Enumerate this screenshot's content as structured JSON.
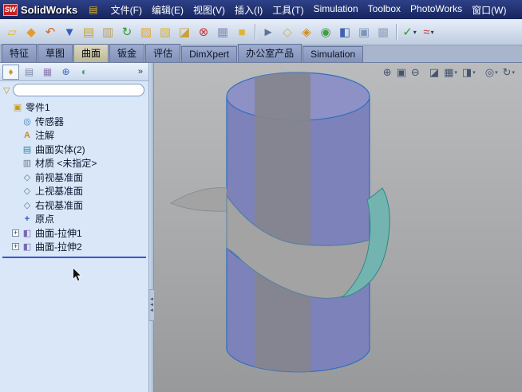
{
  "app": {
    "logo_badge": "SW",
    "logo_text": "SolidWorks"
  },
  "glyphs": {
    "doc_icon": "▤",
    "caret": "▾",
    "plus": "+",
    "overflow": "»",
    "funnel": "▽",
    "splitter_arrow": "◄"
  },
  "colors": {
    "brand_red": "#c42222",
    "edge_blue": "#2e6fc0",
    "cylinder_fill": "#7e82ba",
    "cylinder_top_fill": "#8d91c6",
    "stripe_fill": "#85858d",
    "surface_fill": "#a3a3a3",
    "surface_back_fill": "#74b4b0",
    "surface_edge": "#2e8a86",
    "rollback_blue": "#3a56d4"
  },
  "menu": {
    "items": [
      {
        "name": "menu-file",
        "label": "文件(F)"
      },
      {
        "name": "menu-edit",
        "label": "编辑(E)"
      },
      {
        "name": "menu-view",
        "label": "视图(V)"
      },
      {
        "name": "menu-insert",
        "label": "插入(I)"
      },
      {
        "name": "menu-tools",
        "label": "工具(T)"
      },
      {
        "name": "menu-simulation",
        "label": "Simulation"
      },
      {
        "name": "menu-toolbox",
        "label": "Toolbox"
      },
      {
        "name": "menu-photoworks",
        "label": "PhotoWorks"
      },
      {
        "name": "menu-window",
        "label": "窗口(W)"
      }
    ]
  },
  "toolbar": {
    "buttons": [
      {
        "name": "new-document-button",
        "glyph": "▱",
        "color": "#e7b52f"
      },
      {
        "name": "open-document-button",
        "glyph": "◆",
        "color": "#e59b28"
      },
      {
        "name": "undo-button",
        "glyph": "↶",
        "color": "#d2691e"
      },
      {
        "name": "save-button",
        "glyph": "▼",
        "color": "#2f5fc0"
      },
      {
        "name": "print-button",
        "glyph": "▤",
        "color": "#caa22e"
      },
      {
        "name": "print-preview-button",
        "glyph": "▥",
        "color": "#b8a060"
      },
      {
        "name": "rebuild-button",
        "glyph": "↻",
        "color": "#2f9e2f"
      },
      {
        "name": "open-folder-button",
        "glyph": "▨",
        "color": "#e5a428"
      },
      {
        "name": "make-drawing-button",
        "glyph": "▧",
        "color": "#d9b232"
      },
      {
        "name": "make-assembly-button",
        "glyph": "◪",
        "color": "#c9a232"
      },
      {
        "name": "delete-button",
        "glyph": "⊗",
        "color": "#cc3333"
      },
      {
        "name": "sheet-button",
        "glyph": "▦",
        "color": "#7f93b5"
      },
      {
        "name": "box-button",
        "glyph": "■",
        "color": "#ddb53a"
      },
      {
        "type": "sep"
      },
      {
        "name": "select-button",
        "glyph": "►",
        "color": "#5d7294"
      },
      {
        "name": "sketch-button",
        "glyph": "◇",
        "color": "#d9b232"
      },
      {
        "name": "dimension-button",
        "glyph": "◈",
        "color": "#c98f2a"
      },
      {
        "name": "measure-button",
        "glyph": "◉",
        "color": "#3f9e3f"
      },
      {
        "name": "section-button",
        "glyph": "◧",
        "color": "#3f63ae"
      },
      {
        "name": "view-settings-button",
        "glyph": "▣",
        "color": "#8195b7"
      },
      {
        "name": "tools-button",
        "glyph": "▩",
        "color": "#93a3bd"
      },
      {
        "type": "sep"
      },
      {
        "name": "select-filter-button",
        "glyph": "✓",
        "color": "#2f9e2f",
        "caret": true
      },
      {
        "name": "spline-button",
        "glyph": "≈",
        "color": "#c03a3a",
        "caret": true
      }
    ]
  },
  "command_tabs": {
    "tabs": [
      {
        "name": "tab-features",
        "label": "特征",
        "active": false
      },
      {
        "name": "tab-sketch",
        "label": "草图",
        "active": false
      },
      {
        "name": "tab-surfaces",
        "label": "曲面",
        "active": true
      },
      {
        "name": "tab-sheet-metal",
        "label": "钣金",
        "active": false
      },
      {
        "name": "tab-evaluate",
        "label": "评估",
        "active": false
      },
      {
        "name": "tab-dimxpert",
        "label": "DimXpert",
        "active": false
      },
      {
        "name": "tab-office-products",
        "label": "办公室产品",
        "active": false
      },
      {
        "name": "tab-simulation",
        "label": "Simulation",
        "active": false
      }
    ]
  },
  "feature_panel": {
    "overflow_label": "»",
    "tabs": [
      {
        "name": "featuremanager-tab",
        "glyph": "♦",
        "color": "#c79a28",
        "active": true
      },
      {
        "name": "propertymanager-tab",
        "glyph": "▤",
        "color": "#7a8aa8",
        "active": false
      },
      {
        "name": "configurationmanager-tab",
        "glyph": "▦",
        "color": "#8a7ab0",
        "active": false
      },
      {
        "name": "dimxpertmanager-tab",
        "glyph": "⊕",
        "color": "#3a6ac0",
        "active": false
      },
      {
        "name": "displaymanager-tab",
        "glyph": "◐",
        "color": "#3a9a6a",
        "active": false
      }
    ],
    "filter": {
      "value": ""
    },
    "tree": {
      "items": [
        {
          "name": "tree-item-part",
          "label": "零件1",
          "icon": "part-icon",
          "glyph": "▣",
          "color": "#c79a28",
          "indent": 0,
          "expander": "none"
        },
        {
          "name": "tree-item-sensors",
          "label": "传感器",
          "icon": "sensors-icon",
          "glyph": "◎",
          "color": "#3a7ac0",
          "indent": 1,
          "expander": "none"
        },
        {
          "name": "tree-item-annotations",
          "label": "注解",
          "icon": "annotations-icon",
          "glyph": "A",
          "color": "#d08a20",
          "indent": 1,
          "expander": "none"
        },
        {
          "name": "tree-item-surface-bodies",
          "label": "曲面实体(2)",
          "icon": "surface-bodies-icon",
          "glyph": "▤",
          "color": "#2a8aa0",
          "indent": 1,
          "expander": "none"
        },
        {
          "name": "tree-item-material",
          "label": "材质 <未指定>",
          "icon": "material-icon",
          "glyph": "▥",
          "color": "#6a7a90",
          "indent": 1,
          "expander": "none"
        },
        {
          "name": "tree-item-front-plane",
          "label": "前视基准面",
          "icon": "plane-icon",
          "glyph": "◇",
          "color": "#5a7aa0",
          "indent": 1,
          "expander": "none"
        },
        {
          "name": "tree-item-top-plane",
          "label": "上视基准面",
          "icon": "plane-icon",
          "glyph": "◇",
          "color": "#5a7aa0",
          "indent": 1,
          "expander": "none"
        },
        {
          "name": "tree-item-right-plane",
          "label": "右视基准面",
          "icon": "plane-icon",
          "glyph": "◇",
          "color": "#5a7aa0",
          "indent": 1,
          "expander": "none"
        },
        {
          "name": "tree-item-origin",
          "label": "原点",
          "icon": "origin-icon",
          "glyph": "+",
          "color": "#2a5ac0",
          "indent": 1,
          "expander": "none"
        },
        {
          "name": "tree-item-surface-extrude1",
          "label": "曲面-拉伸1",
          "icon": "surface-extrude-icon",
          "glyph": "◧",
          "color": "#7a6ab0",
          "indent": 1,
          "expander": "plus"
        },
        {
          "name": "tree-item-surface-extrude2",
          "label": "曲面-拉伸2",
          "icon": "surface-extrude-icon",
          "glyph": "◧",
          "color": "#7a6ab0",
          "indent": 1,
          "expander": "plus"
        }
      ]
    }
  },
  "viewport": {
    "hud_icons": [
      {
        "name": "zoom-fit-icon",
        "glyph": "⊕"
      },
      {
        "name": "zoom-area-icon",
        "glyph": "▣"
      },
      {
        "name": "zoom-in-out-icon",
        "glyph": "⊖"
      },
      {
        "name": "section-view-icon",
        "glyph": "◪"
      },
      {
        "name": "view-orientation-icon",
        "glyph": "▦",
        "caret": true
      },
      {
        "name": "display-style-icon",
        "glyph": "◨",
        "caret": true
      },
      {
        "name": "hide-show-items-icon",
        "glyph": "◎",
        "caret": true
      },
      {
        "name": "appearance-icon",
        "glyph": "↻",
        "caret": true
      }
    ]
  }
}
